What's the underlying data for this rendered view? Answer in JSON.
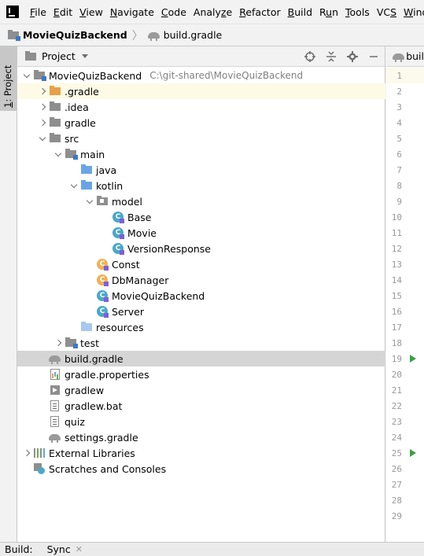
{
  "menu": {
    "items": [
      {
        "mn": "F",
        "rest": "ile"
      },
      {
        "mn": "E",
        "rest": "dit"
      },
      {
        "mn": "V",
        "rest": "iew"
      },
      {
        "mn": "N",
        "rest": "avigate"
      },
      {
        "mn": "C",
        "rest": "ode"
      },
      {
        "pre": "Analy",
        "mn": "z",
        "rest": "e"
      },
      {
        "mn": "R",
        "rest": "efactor"
      },
      {
        "mn": "B",
        "rest": "uild"
      },
      {
        "pre": "R",
        "mn": "u",
        "rest": "n"
      },
      {
        "mn": "T",
        "rest": "ools"
      },
      {
        "pre": "VC",
        "mn": "S",
        "rest": ""
      },
      {
        "mn": "W",
        "rest": "indow"
      }
    ]
  },
  "breadcrumb": {
    "project": "MovieQuizBackend",
    "file": "build.gradle"
  },
  "stripe": {
    "project_tab_mn": "1",
    "project_tab_rest": ": Project"
  },
  "panel": {
    "title": "Project"
  },
  "tree": [
    {
      "name": "MovieQuizBackend",
      "hint": "C:\\git-shared\\MovieQuizBackend",
      "icon": "folder-module-icon",
      "depth": 0,
      "toggle": "expanded"
    },
    {
      "name": ".gradle",
      "icon": "folder-excluded-icon",
      "depth": 1,
      "toggle": "collapsed",
      "highlight": true
    },
    {
      "name": ".idea",
      "icon": "folder-icon",
      "depth": 1,
      "toggle": "collapsed"
    },
    {
      "name": "gradle",
      "icon": "folder-icon",
      "depth": 1,
      "toggle": "collapsed"
    },
    {
      "name": "src",
      "icon": "folder-icon",
      "depth": 1,
      "toggle": "expanded"
    },
    {
      "name": "main",
      "icon": "folder-module-icon",
      "depth": 2,
      "toggle": "expanded"
    },
    {
      "name": "java",
      "icon": "source-folder-icon",
      "depth": 3,
      "toggle": "none"
    },
    {
      "name": "kotlin",
      "icon": "source-folder-icon",
      "depth": 3,
      "toggle": "expanded"
    },
    {
      "name": "model",
      "icon": "package-icon",
      "depth": 4,
      "toggle": "expanded"
    },
    {
      "name": "Base",
      "icon": "kotlin-class-icon",
      "depth": 5,
      "toggle": "none"
    },
    {
      "name": "Movie",
      "icon": "kotlin-class-icon",
      "depth": 5,
      "toggle": "none"
    },
    {
      "name": "VersionResponse",
      "icon": "kotlin-class-icon",
      "depth": 5,
      "toggle": "none"
    },
    {
      "name": "Const",
      "icon": "kotlin-object-icon",
      "depth": 4,
      "toggle": "none"
    },
    {
      "name": "DbManager",
      "icon": "kotlin-object-icon",
      "depth": 4,
      "toggle": "none"
    },
    {
      "name": "MovieQuizBackend",
      "icon": "kotlin-class-icon",
      "depth": 4,
      "toggle": "none"
    },
    {
      "name": "Server",
      "icon": "kotlin-class-icon",
      "depth": 4,
      "toggle": "none"
    },
    {
      "name": "resources",
      "icon": "resources-folder-icon",
      "depth": 3,
      "toggle": "none"
    },
    {
      "name": "test",
      "icon": "folder-module-icon",
      "depth": 2,
      "toggle": "collapsed"
    },
    {
      "name": "build.gradle",
      "icon": "gradle-icon",
      "depth": 1,
      "toggle": "none",
      "selected": true
    },
    {
      "name": "gradle.properties",
      "icon": "properties-file-icon",
      "depth": 1,
      "toggle": "none"
    },
    {
      "name": "gradlew",
      "icon": "executable-file-icon",
      "depth": 1,
      "toggle": "none"
    },
    {
      "name": "gradlew.bat",
      "icon": "text-file-icon",
      "depth": 1,
      "toggle": "none"
    },
    {
      "name": "quiz",
      "icon": "text-file-icon",
      "depth": 1,
      "toggle": "none"
    },
    {
      "name": "settings.gradle",
      "icon": "gradle-icon",
      "depth": 1,
      "toggle": "none"
    },
    {
      "name": "External Libraries",
      "icon": "external-libraries-icon",
      "depth": 0,
      "toggle": "collapsed"
    },
    {
      "name": "Scratches and Consoles",
      "icon": "scratches-icon",
      "depth": 0,
      "toggle": "none"
    }
  ],
  "editor": {
    "tab_label": "buil",
    "lines": [
      "1",
      "2",
      "3",
      "4",
      "5",
      "6",
      "7",
      "8",
      "9",
      "10",
      "11",
      "12",
      "13",
      "14",
      "15",
      "16",
      "17",
      "18",
      "19",
      "20",
      "21",
      "22",
      "23",
      "24",
      "25",
      "26",
      "27",
      "28",
      "29"
    ],
    "run_lines": [
      "19",
      "25"
    ],
    "current_line": "1"
  },
  "bottombar": {
    "label": "Build:",
    "tab": "Sync"
  },
  "colors": {
    "selection": "#d5d5d5",
    "highlight_row": "#fdfbe6",
    "hint": "#808080",
    "run_green": "#3c9f45"
  }
}
